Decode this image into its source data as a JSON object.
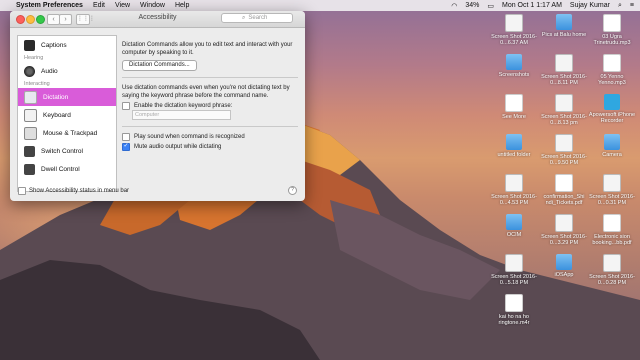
{
  "menubar": {
    "app_name": "System Preferences",
    "items": [
      "Edit",
      "View",
      "Window",
      "Help"
    ],
    "battery": "34%",
    "datetime": "Mon Oct 1  1:17 AM",
    "user": "Sujay Kumar"
  },
  "window": {
    "title": "Accessibility",
    "search_placeholder": "Search",
    "show_status_label": "Show Accessibility status in menu bar"
  },
  "sidebar": {
    "items": [
      {
        "label": "Captions",
        "icon": "captions-icon"
      },
      {
        "section": "Hearing"
      },
      {
        "label": "Audio",
        "icon": "speaker-icon"
      },
      {
        "section": "Interacting"
      },
      {
        "label": "Dictation",
        "icon": "microphone-icon",
        "selected": true
      },
      {
        "label": "Keyboard",
        "icon": "keyboard-icon"
      },
      {
        "label": "Mouse & Trackpad",
        "icon": "mouse-icon"
      },
      {
        "label": "Switch Control",
        "icon": "switch-control-icon"
      },
      {
        "label": "Dwell Control",
        "icon": "dwell-control-icon"
      }
    ]
  },
  "content": {
    "intro": "Dictation Commands allow you to edit text and interact with your computer by speaking to it.",
    "commands_button": "Dictation Commands...",
    "keyword_help": "Use dictation commands even when you're not dictating text by saying the keyword phrase before the command name.",
    "enable_keyword_label": "Enable the dictation keyword phrase:",
    "keyword_placeholder": "Computer",
    "play_sound_label": "Play sound when command is recognized",
    "mute_audio_label": "Mute audio output while dictating",
    "help_label": "?"
  },
  "desktop_icons": [
    {
      "label": "Screen Shot 2016-0...6.37 AM",
      "kind": "screenshot"
    },
    {
      "label": "Pics at Balu home",
      "kind": "folder"
    },
    {
      "label": "03 Ugra Trinetrudu.mp3",
      "kind": "audio"
    },
    {
      "label": "Screenshots",
      "kind": "folder"
    },
    {
      "label": "Screen Shot 2016-0...8.11 PM",
      "kind": "screenshot"
    },
    {
      "label": "05 Yenno Yenno.mp3",
      "kind": "audio"
    },
    {
      "label": "See More",
      "kind": "document"
    },
    {
      "label": "Screen Shot 2016-0...8.13 pm",
      "kind": "screenshot"
    },
    {
      "label": "Apowersoft iPhone Recorder",
      "kind": "app"
    },
    {
      "label": "untitled folder",
      "kind": "folder"
    },
    {
      "label": "Screen Shot 2016-0...9.50 PM",
      "kind": "screenshot"
    },
    {
      "label": "Camera",
      "kind": "folder"
    },
    {
      "label": "Screen Shot 2016-0...4.53 PM",
      "kind": "screenshot"
    },
    {
      "label": "confirmation_Shi ndi_Tickets.pdf",
      "kind": "pdf"
    },
    {
      "label": "Screen Shot 2016-0...0.31 PM",
      "kind": "screenshot"
    },
    {
      "label": "OCIM",
      "kind": "folder"
    },
    {
      "label": "Screen Shot 2016-0...3.29 PM",
      "kind": "screenshot"
    },
    {
      "label": "Electronic sion booking...bb.pdf",
      "kind": "pdf"
    },
    {
      "label": "Screen Shot 2016-0...5.18 PM",
      "kind": "screenshot"
    },
    {
      "label": "iOSApp",
      "kind": "folder"
    },
    {
      "label": "Screen Shot 2016-0...0.28 PM",
      "kind": "screenshot"
    },
    {
      "label": "kai ho na ho ringtone.m4r",
      "kind": "audio"
    }
  ]
}
